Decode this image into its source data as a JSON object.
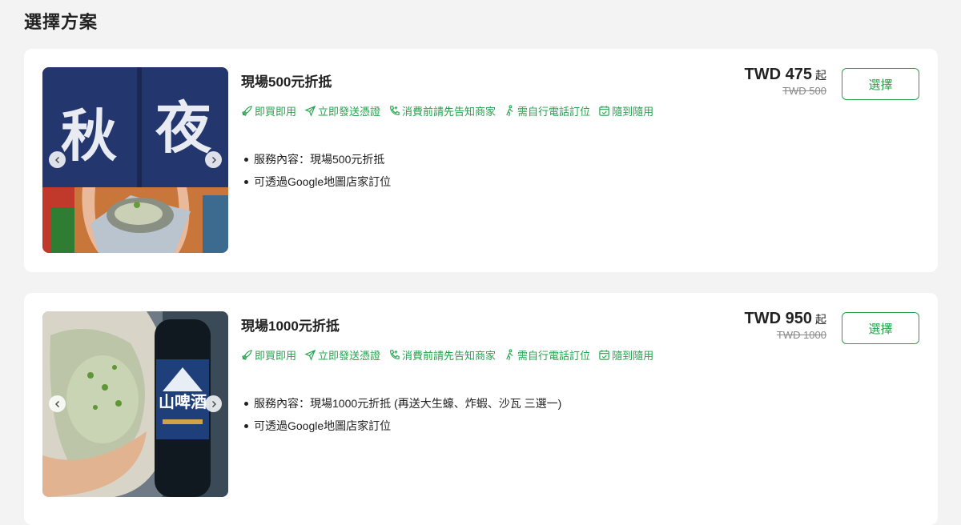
{
  "section_title": "選擇方案",
  "colors": {
    "accent": "#22a34b",
    "background": "#f3f3f3",
    "card": "#ffffff"
  },
  "plans": [
    {
      "title": "現場500元折抵",
      "features": [
        {
          "icon": "rocket-icon",
          "label": "即買即用"
        },
        {
          "icon": "send-icon",
          "label": "立即發送憑證"
        },
        {
          "icon": "phone-icon",
          "label": "消費前請先告知商家"
        },
        {
          "icon": "walk-icon",
          "label": "需自行電話訂位"
        },
        {
          "icon": "calendar-check-icon",
          "label": "隨到隨用"
        }
      ],
      "description": [
        "服務內容：現場500元折抵",
        "可透過Google地圖店家訂位"
      ],
      "price": "TWD 475",
      "price_suffix": "起",
      "original_price": "TWD 500",
      "select_label": "選擇",
      "image_banner_text": [
        "秋",
        "夜"
      ]
    },
    {
      "title": "現場1000元折抵",
      "features": [
        {
          "icon": "rocket-icon",
          "label": "即買即用"
        },
        {
          "icon": "send-icon",
          "label": "立即發送憑證"
        },
        {
          "icon": "phone-icon",
          "label": "消費前請先告知商家"
        },
        {
          "icon": "walk-icon",
          "label": "需自行電話訂位"
        },
        {
          "icon": "calendar-check-icon",
          "label": "隨到隨用"
        }
      ],
      "description": [
        "服務內容：現場1000元折抵 (再送大生蠔、炸蝦、沙瓦 三選一)",
        "可透過Google地圖店家訂位"
      ],
      "price": "TWD 950",
      "price_suffix": "起",
      "original_price": "TWD 1000",
      "select_label": "選擇",
      "image_banner_text": [
        "山啤酒"
      ]
    }
  ]
}
